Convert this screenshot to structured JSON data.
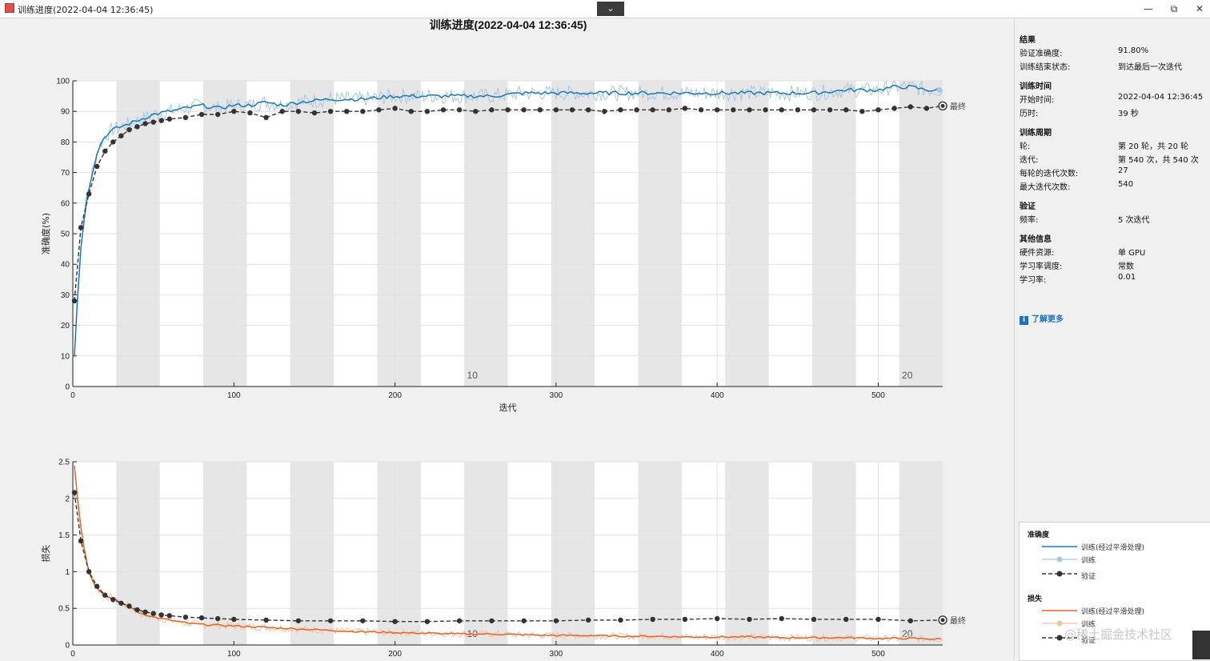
{
  "window": {
    "title": "训练进度(2022-04-04 12:36:45)",
    "collapse_icon": "chevron-down-icon",
    "minimize": "—",
    "restore": "⧉",
    "close": "✕"
  },
  "main_title": "训练进度(2022-04-04 12:36:45)",
  "side": {
    "results_header": "结果",
    "val_acc_label": "验证准确度:",
    "val_acc_value": "91.80%",
    "end_state_label": "训练结束状态:",
    "end_state_value": "到达最后一次迭代",
    "time_header": "训练时间",
    "start_label": "开始时间:",
    "start_value": "2022-04-04 12:36:45",
    "elapsed_label": "历时:",
    "elapsed_value": "39 秒",
    "cycle_header": "训练周期",
    "epoch_label": "轮:",
    "epoch_value": "第 20 轮，共 20 轮",
    "iter_label": "迭代:",
    "iter_value": "第 540 次，共 540 次",
    "iter_per_epoch_label": "每轮的迭代次数:",
    "iter_per_epoch_value": "27",
    "max_iter_label": "最大迭代次数:",
    "max_iter_value": "540",
    "val_header": "验证",
    "freq_label": "频率:",
    "freq_value": "5 次迭代",
    "other_header": "其他信息",
    "hw_label": "硬件资源:",
    "hw_value": "单 GPU",
    "lr_sched_label": "学习率调度:",
    "lr_sched_value": "常数",
    "lr_label": "学习率:",
    "lr_value": "0.01",
    "learn_more": "了解更多"
  },
  "legend": {
    "acc_header": "准确度",
    "acc_smooth": "训练(经过平滑处理)",
    "acc_train": "训练",
    "acc_val": "验证",
    "loss_header": "损失",
    "loss_smooth": "训练(经过平滑处理)",
    "loss_train": "训练",
    "loss_val": "验证"
  },
  "watermark": "@稀土掘金技术社区",
  "colors": {
    "acc_smooth": "#1f77b4",
    "acc_raw": "#a9c8e3",
    "loss_smooth": "#e0662a",
    "loss_raw": "#f3c2a6",
    "validation": "#333333",
    "epoch_band": "#e6e6e6"
  },
  "chart_data": [
    {
      "type": "line",
      "ylabel": "准确度(%)",
      "xlabel": "迭代",
      "xlim": [
        0,
        540
      ],
      "ylim": [
        0,
        100
      ],
      "xticks": [
        0,
        100,
        200,
        300,
        400,
        500
      ],
      "yticks": [
        0,
        10,
        20,
        30,
        40,
        50,
        60,
        70,
        80,
        90,
        100
      ],
      "epoch_labels": [
        {
          "x": 248,
          "label": "10"
        },
        {
          "x": 518,
          "label": "20"
        }
      ],
      "final_label": "最终",
      "series": [
        {
          "name": "训练(经过平滑处理)",
          "x": [
            1,
            3,
            5,
            8,
            10,
            13,
            16,
            20,
            25,
            30,
            35,
            40,
            45,
            50,
            60,
            70,
            80,
            90,
            100,
            110,
            120,
            130,
            140,
            160,
            180,
            200,
            220,
            240,
            260,
            280,
            300,
            320,
            340,
            360,
            380,
            400,
            420,
            440,
            460,
            480,
            500,
            510,
            520,
            530,
            540
          ],
          "y": [
            10,
            30,
            45,
            60,
            65,
            72,
            78,
            82,
            84,
            85,
            86,
            87,
            88,
            89,
            90,
            91,
            92,
            91,
            92,
            92,
            93,
            92,
            93,
            94,
            94,
            95,
            95,
            95,
            95,
            96,
            96,
            96,
            96,
            96,
            96,
            96,
            96,
            96,
            96,
            97,
            97,
            98,
            98,
            97,
            97
          ]
        },
        {
          "name": "验证",
          "x": [
            1,
            5,
            10,
            15,
            20,
            25,
            30,
            35,
            40,
            45,
            50,
            55,
            60,
            70,
            80,
            90,
            100,
            110,
            120,
            130,
            140,
            150,
            160,
            170,
            180,
            190,
            200,
            210,
            220,
            230,
            240,
            250,
            260,
            270,
            280,
            290,
            300,
            310,
            320,
            330,
            340,
            350,
            360,
            370,
            380,
            390,
            400,
            410,
            420,
            430,
            440,
            450,
            460,
            470,
            480,
            490,
            500,
            510,
            520,
            530,
            540
          ],
          "y": [
            28,
            52,
            63,
            72,
            77,
            80,
            82,
            84,
            85,
            86,
            86.5,
            87,
            87.5,
            88,
            89,
            89,
            90,
            89.5,
            88,
            90,
            90,
            89.5,
            90,
            90,
            90,
            90.5,
            91,
            90,
            90,
            90.5,
            90.5,
            90,
            90.5,
            90.5,
            90.5,
            90.5,
            90.5,
            90.5,
            90.5,
            90,
            90.5,
            90.5,
            90.5,
            90.5,
            91,
            90.5,
            90.5,
            90.5,
            90.5,
            90.5,
            90.5,
            90.5,
            90.5,
            90.5,
            90.5,
            90,
            90.5,
            91,
            91.5,
            91,
            91.8
          ]
        }
      ]
    },
    {
      "type": "line",
      "ylabel": "损失",
      "xlabel": "迭代",
      "xlim": [
        0,
        540
      ],
      "ylim": [
        0,
        2.5
      ],
      "xticks": [
        0,
        100,
        200,
        300,
        400,
        500
      ],
      "yticks": [
        0,
        0.5,
        1,
        1.5,
        2,
        2.5
      ],
      "epoch_labels": [
        {
          "x": 248,
          "label": "10"
        },
        {
          "x": 518,
          "label": "20"
        }
      ],
      "final_label": "最终",
      "series": [
        {
          "name": "训练(经过平滑处理)",
          "x": [
            1,
            3,
            5,
            8,
            10,
            13,
            16,
            20,
            25,
            30,
            35,
            40,
            50,
            60,
            70,
            80,
            90,
            100,
            120,
            140,
            160,
            180,
            200,
            220,
            240,
            260,
            280,
            300,
            320,
            340,
            360,
            380,
            400,
            420,
            440,
            460,
            480,
            500,
            520,
            540
          ],
          "y": [
            2.45,
            2.0,
            1.6,
            1.2,
            1.0,
            0.85,
            0.75,
            0.68,
            0.62,
            0.58,
            0.52,
            0.45,
            0.38,
            0.34,
            0.3,
            0.28,
            0.27,
            0.26,
            0.24,
            0.22,
            0.2,
            0.18,
            0.17,
            0.16,
            0.15,
            0.15,
            0.14,
            0.13,
            0.13,
            0.12,
            0.12,
            0.11,
            0.11,
            0.11,
            0.1,
            0.1,
            0.1,
            0.09,
            0.09,
            0.08
          ]
        },
        {
          "name": "验证",
          "x": [
            1,
            5,
            10,
            15,
            20,
            25,
            30,
            35,
            40,
            45,
            50,
            55,
            60,
            70,
            80,
            90,
            100,
            120,
            140,
            160,
            180,
            200,
            220,
            240,
            260,
            280,
            300,
            320,
            340,
            360,
            380,
            400,
            420,
            440,
            460,
            480,
            500,
            520,
            540
          ],
          "y": [
            2.08,
            1.42,
            1.0,
            0.8,
            0.68,
            0.62,
            0.57,
            0.53,
            0.48,
            0.45,
            0.43,
            0.41,
            0.4,
            0.38,
            0.37,
            0.36,
            0.35,
            0.34,
            0.33,
            0.33,
            0.33,
            0.32,
            0.32,
            0.33,
            0.33,
            0.33,
            0.33,
            0.34,
            0.34,
            0.35,
            0.35,
            0.36,
            0.35,
            0.36,
            0.35,
            0.35,
            0.35,
            0.33,
            0.34
          ]
        }
      ]
    }
  ]
}
